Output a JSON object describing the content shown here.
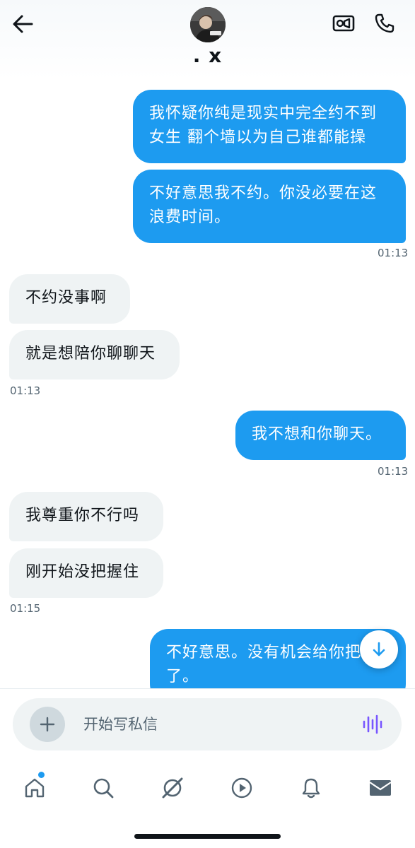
{
  "header": {
    "contact_name": ". x",
    "back_icon": "arrow-left-icon",
    "video_icon": "video-camera-icon",
    "call_icon": "phone-icon"
  },
  "messages": [
    {
      "direction": "sent",
      "text_lines": [
        "我怀疑你纯是现实中完全约不到",
        "女生 翻个墙以为自己谁都能操"
      ]
    },
    {
      "direction": "sent",
      "text_lines": [
        "不好意思我不约。你没必要在这",
        "浪费时间。"
      ]
    },
    {
      "time": "01:13"
    },
    {
      "direction": "received",
      "text": "不约没事啊"
    },
    {
      "direction": "received",
      "text": "就是想陪你聊聊天"
    },
    {
      "time": "01:13"
    },
    {
      "direction": "sent",
      "text": "我不想和你聊天。"
    },
    {
      "time": "01:13"
    },
    {
      "direction": "received",
      "text": "我尊重你不行吗"
    },
    {
      "direction": "received",
      "text": "刚开始没把握住"
    },
    {
      "time": "01:15"
    },
    {
      "direction": "sent",
      "text_lines": [
        "不好意思。没有机会给你把",
        "了。"
      ]
    }
  ],
  "scroll_button": {
    "icon": "arrow-down-icon"
  },
  "composer": {
    "placeholder": "开始写私信",
    "add_icon": "plus-icon",
    "voice_icon": "voice-waveform-icon"
  },
  "bottom_nav": {
    "items": [
      "home-icon",
      "search-icon",
      "grok-icon",
      "video-play-icon",
      "bell-icon",
      "mail-icon"
    ],
    "active": "mail-icon",
    "home_has_notification_dot": true
  },
  "colors": {
    "sent_bubble": "#1d9bf0",
    "received_bubble": "#eff3f4",
    "timestamp": "#536471",
    "voice_icon": "#7856ff"
  }
}
